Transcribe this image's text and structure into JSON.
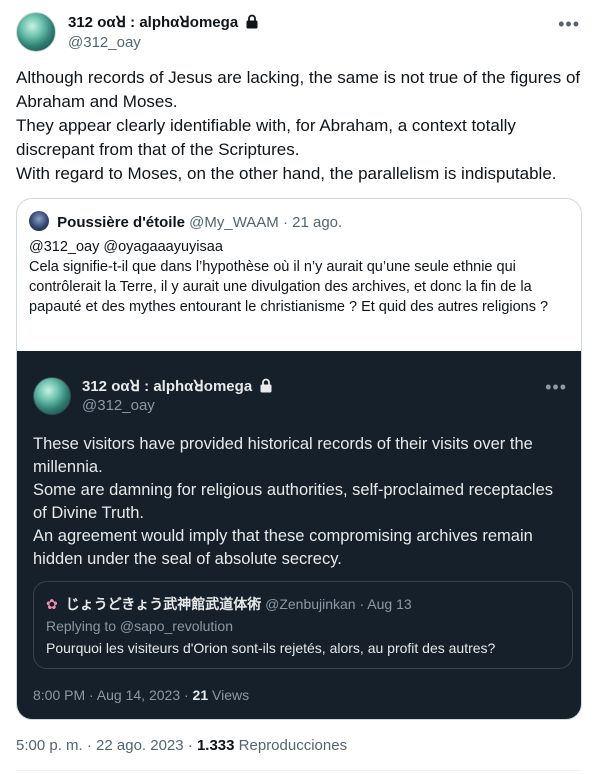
{
  "author": {
    "name": "312 οαꓤ : alphαꓤomega",
    "handle": "@312_oay"
  },
  "tweet_lines": [
    "Although records of Jesus are lacking, the same is not true of the figures of Abraham and Moses.",
    "They appear clearly identifiable with, for Abraham, a context totally discrepant from that of the Scriptures.",
    "With regard to Moses, on the other hand, the parallelism is indisputable."
  ],
  "quoted": {
    "name": "Poussière d'étoile",
    "handle": "@My_WAAM",
    "date": "21 ago.",
    "mentions": "@312_oay @oyagaaayuyisaa",
    "text": "Cela signifie-t-il que dans l’hypothèse où il n’y aurait qu’une seule ethnie qui contrôlerait la Terre, il y aurait une divulgation des archives, et donc la fin de la papauté et des mythes entourant le christianisme ? Et quid des autres religions ?"
  },
  "embedded": {
    "name": "312 οαꓤ : alphαꓤomega",
    "handle": "@312_oay",
    "lines": [
      "These visitors have provided historical records of their visits over the millennia.",
      "Some are damning for religious authorities, self-proclaimed receptacles of Divine Truth.",
      "An agreement would imply that these compromising archives remain hidden under the seal of absolute secrecy."
    ],
    "inner_quote": {
      "name": "じょうどきょう武神館武道体術",
      "handle": "@Zenbujinkan",
      "date": "Aug 13",
      "replying_to": "Replying to @sapo_revolution",
      "text": "Pourquoi les visiteurs d'Orion sont-ils rejetés, alors, au profit des autres?"
    },
    "timestamp": "8:00 PM · Aug 14, 2023 ·",
    "views_count": "21",
    "views_label": "Views"
  },
  "footer": {
    "timestamp": "5:00 p. m. · 22 ago. 2023 ·",
    "views_count": "1.333",
    "views_label": "Reproducciones"
  },
  "icons": {
    "lock": "lock-icon",
    "more": "more-icon",
    "flower": "flower-icon"
  },
  "colors": {
    "text": "#0f1419",
    "muted": "#536471",
    "dark_bg": "#15202b"
  }
}
